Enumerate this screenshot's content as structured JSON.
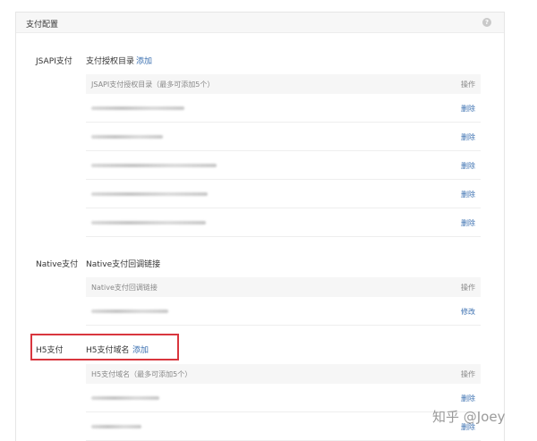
{
  "panel": {
    "title": "支付配置",
    "help_icon": "question-icon"
  },
  "jsapi": {
    "label": "JSAPI支付",
    "sub_label": "支付授权目录",
    "add_label": "添加",
    "col_main": "JSAPI支付授权目录（最多可添加5个）",
    "col_op": "操作",
    "rows": [
      {
        "op": "删除"
      },
      {
        "op": "删除"
      },
      {
        "op": "删除"
      },
      {
        "op": "删除"
      },
      {
        "op": "删除"
      }
    ]
  },
  "native": {
    "label": "Native支付",
    "sub_label": "Native支付回调链接",
    "col_main": "Native支付回调链接",
    "col_op": "操作",
    "rows": [
      {
        "op": "修改"
      }
    ]
  },
  "h5": {
    "label": "H5支付",
    "sub_label": "H5支付域名",
    "add_label": "添加",
    "col_main": "H5支付域名（最多可添加5个）",
    "col_op": "操作",
    "rows": [
      {
        "op": "删除"
      },
      {
        "op": "删除"
      }
    ]
  },
  "watermark": "知乎 @Joey",
  "colors": {
    "link": "#3a6fb0",
    "highlight": "#d9363e"
  }
}
